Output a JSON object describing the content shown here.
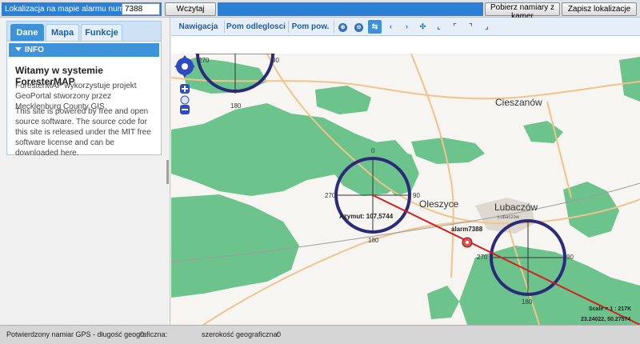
{
  "topbar": {
    "alarm_label": "Lokalizacja na mapie alarmu numer:",
    "alarm_number": "7388",
    "load_label": "Wczytaj",
    "camera_bearings_label": "Pobierz namiary z kamer",
    "save_location_label": "Zapisz lokalizacje"
  },
  "left_panel": {
    "tabs": [
      {
        "label": "Dane",
        "active": true
      },
      {
        "label": "Mapa",
        "active": false
      },
      {
        "label": "Funkcje",
        "active": false
      }
    ],
    "info_header": "INFO",
    "welcome_title": "Witamy w systemie ForesterMAP",
    "paragraph_1": "ForesterMAP wykorzystuje projekt GeoPortal stworzony przez Mecklenburg County GIS.",
    "paragraph_2": "This site is powered by free and open source software. The source code for this site is released under the MIT free software license and can be downloaded here."
  },
  "toolbar": {
    "navigation_label": "Nawigacja",
    "measure_distance_label": "Pom odleglosci",
    "measure_area_label": "Pom pow.",
    "icons": [
      "zoom-in-icon",
      "zoom-out-icon",
      "pan-icon",
      "back-icon",
      "forward-icon",
      "full-extent-icon",
      "previous-extent-icon",
      "next-extent-icon",
      "identify-icon",
      "select-icon"
    ],
    "icon_glyphs": [
      "⊕",
      "⊖",
      "⇆",
      "‹",
      "›",
      "✣",
      "⌞",
      "⌜",
      "⌝",
      "⌟"
    ]
  },
  "map": {
    "places": [
      "Cieszanów",
      "Oleszyce",
      "Lubaczów"
    ],
    "place_small_label": "Lubaczów",
    "alarm_marker_label": "alarm7388",
    "azimuth_label": "Azymut: 107,5744",
    "scale_label": "Scale = 1 : 217K",
    "coords_label": "23.24022, 50.27574",
    "compass_ticks": [
      "0",
      "90",
      "180",
      "270"
    ],
    "colors": {
      "forest": "#6cc38c",
      "road": "#f0c48a",
      "bearing_line": "#d42020",
      "compass_ring": "#2c2a7a",
      "accent": "#3d92da"
    }
  },
  "status_bar": {
    "lon_label": "Potwierdzony namiar GPS - długość geograficzna:",
    "lon_value": "0",
    "lat_label": "szerokość geograficzna:",
    "lat_value": "0"
  }
}
